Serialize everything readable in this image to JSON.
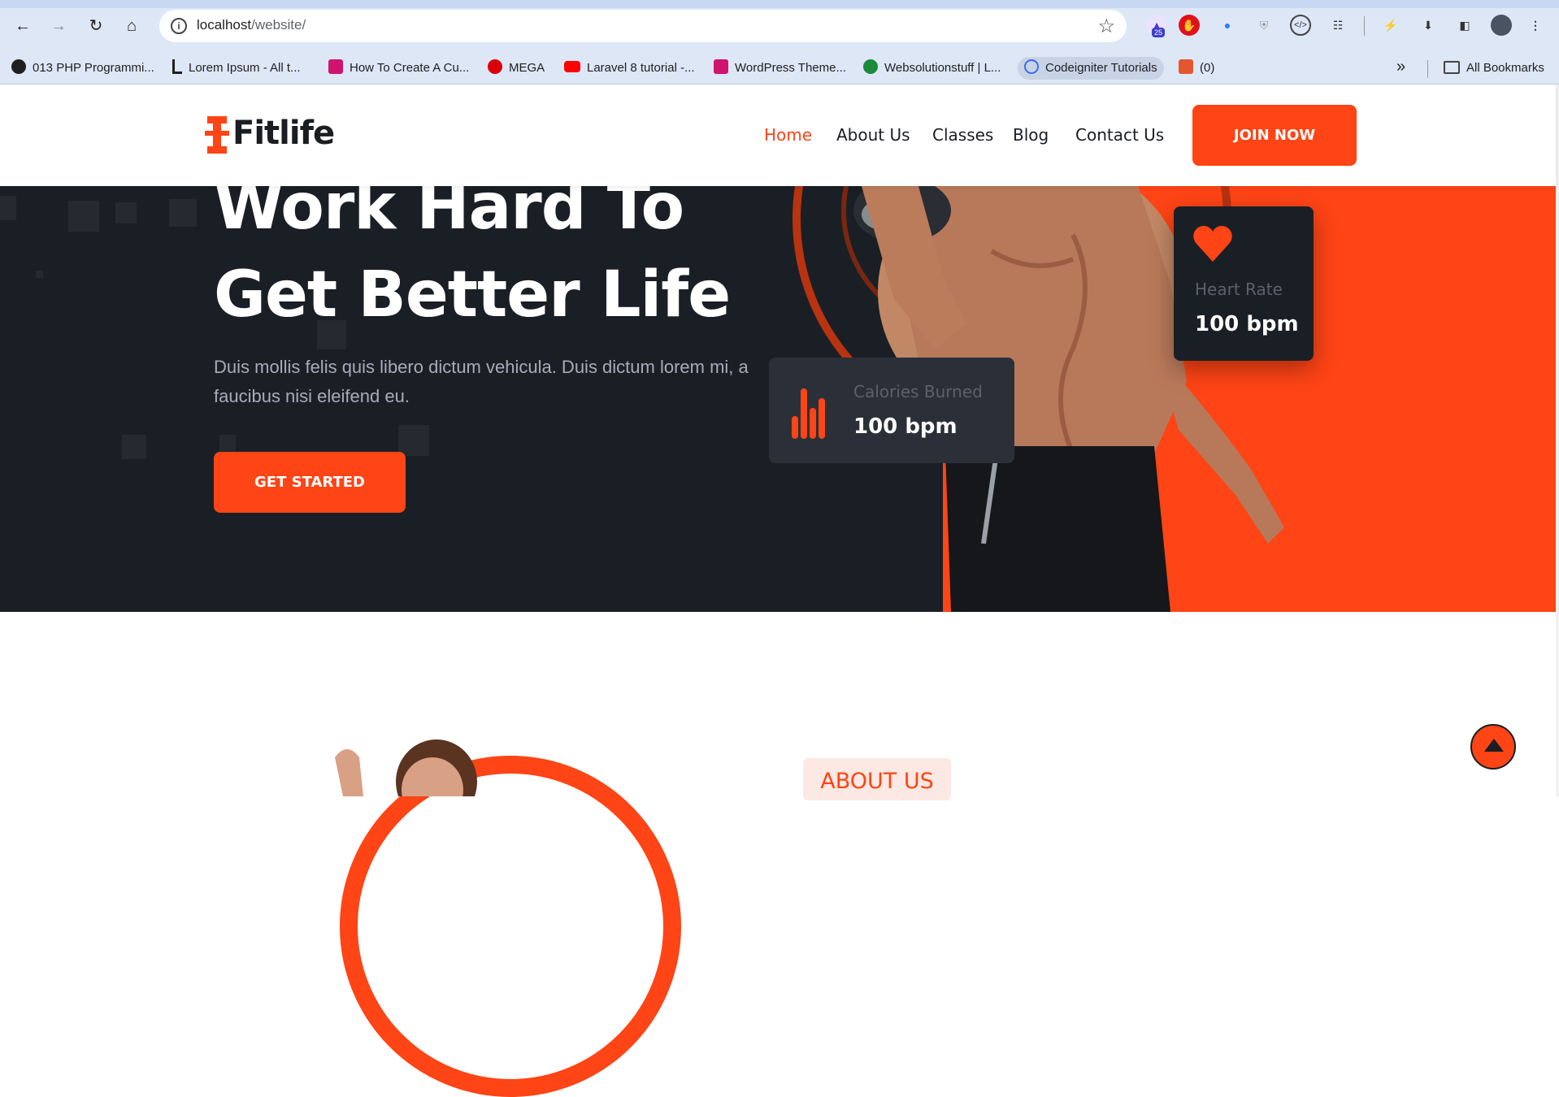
{
  "browser": {
    "url_host": "localhost",
    "url_path": "/website/",
    "extension_badge": "25",
    "bookmarks": [
      {
        "label": "013 PHP Programmi...",
        "icon": "globe-icon",
        "color": "#1f1f1f"
      },
      {
        "label": "Lorem Ipsum - All t...",
        "icon": "lorem-icon",
        "color": "#1f1f1f"
      },
      {
        "label": "How To Create A Cu...",
        "icon": "vimeo-like-icon",
        "color": "#d0146e"
      },
      {
        "label": "MEGA",
        "icon": "mega-icon",
        "color": "#d90007"
      },
      {
        "label": "Laravel 8 tutorial -...",
        "icon": "youtube-icon",
        "color": "#ff0000"
      },
      {
        "label": "WordPress Theme...",
        "icon": "vimeo-like-icon",
        "color": "#d0146e"
      },
      {
        "label": "Websolutionstuff | L...",
        "icon": "w-icon",
        "color": "#1b8a3a"
      },
      {
        "label": "Codeigniter Tutorials",
        "icon": "react-icon",
        "color": "#3a6ee8"
      },
      {
        "label": "(0)",
        "icon": "html-icon",
        "color": "#e4572e"
      }
    ],
    "all_bookmarks": "All Bookmarks"
  },
  "header": {
    "logo_text": "Fitlife",
    "nav": [
      "Home",
      "About Us",
      "Classes",
      "Blog",
      "Contact Us"
    ],
    "join_label": "JOIN NOW"
  },
  "hero": {
    "title_line1": "Work Hard To",
    "title_line2": "Get Better Life",
    "description": "Duis mollis felis quis libero dictum vehicula. Duis dictum lorem mi, a faucibus nisi eleifend eu.",
    "cta_label": "GET STARTED",
    "calories_card": {
      "label": "Calories Burned",
      "value": "100 bpm"
    },
    "heart_card": {
      "label": "Heart Rate",
      "value": "100 bpm"
    }
  },
  "about": {
    "badge": "ABOUT US"
  },
  "colors": {
    "accent": "#ff4415",
    "dark": "#1a1f26"
  }
}
